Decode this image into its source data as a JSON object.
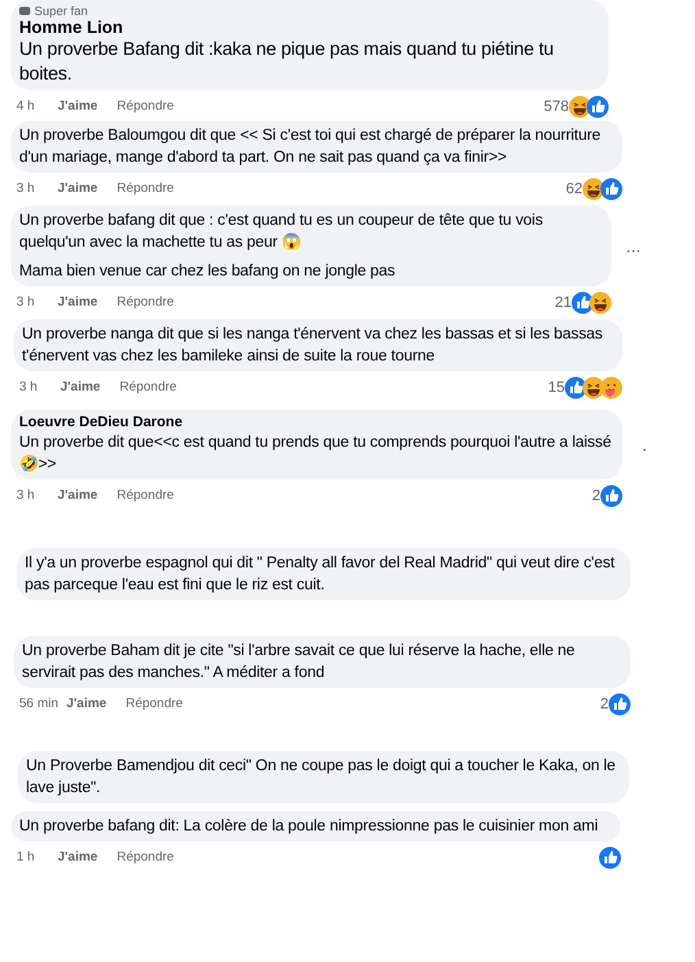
{
  "comments": [
    {
      "badge": "Super fan",
      "author": "Homme Lion",
      "paragraphs": [
        "Un proverbe Bafang dit :kaka ne pique pas mais quand tu piétine tu boites."
      ],
      "time": "4 h",
      "like": "J'aime",
      "reply": "Répondre",
      "count": "578",
      "reactions": [
        {
          "kind": "haha"
        },
        {
          "kind": "like"
        }
      ]
    },
    {
      "paragraphs": [
        "Un proverbe Baloumgou dit que << Si c'est toi qui est chargé de préparer la nourriture d'un mariage, mange d'abord ta part. On ne sait pas quand ça va finir>>"
      ],
      "time": "3 h",
      "like": "J'aime",
      "reply": "Répondre",
      "count": "62",
      "reactions": [
        {
          "kind": "haha"
        },
        {
          "kind": "like"
        }
      ]
    },
    {
      "paragraphs": [
        "Un proverbe bafang dit que : c'est quand tu es un coupeur de tête que tu vois quelqu'un avec la machette tu as peur 😱",
        "Mama bien venue car chez les bafang on ne jongle pas"
      ],
      "time": "3 h",
      "like": "J'aime",
      "reply": "Répondre",
      "count": "21",
      "reactions": [
        {
          "kind": "like"
        },
        {
          "kind": "haha"
        }
      ],
      "menu": "..."
    },
    {
      "paragraphs": [
        "Un proverbe nanga dit que si les nanga t'énervent va chez les bassas et si les bassas t'énervent vas chez les bamileke ainsi de suite la roue tourne"
      ],
      "time": "3 h",
      "like": "J'aime",
      "reply": "Répondre",
      "count": "15",
      "reactions": [
        {
          "kind": "like"
        },
        {
          "kind": "haha"
        },
        {
          "kind": "care"
        }
      ]
    },
    {
      "author": "Loeuvre DeDieu Darone",
      "paragraphs": [
        "Un proverbe dit que<<c est quand tu prends que tu comprends pourquoi l'autre a laissé 🤣>>"
      ],
      "time": "3 h",
      "like": "J'aime",
      "reply": "Répondre",
      "count": "2",
      "reactions": [
        {
          "kind": "like"
        }
      ],
      "menu": "."
    },
    {
      "paragraphs": [
        "Il y'a un proverbe espagnol qui dit \" Penalty all favor del Real Madrid\" qui veut dire c'est pas parceque l'eau est fini que le riz est cuit."
      ]
    },
    {
      "paragraphs": [
        "Un proverbe Baham dit je cite \"si l'arbre savait ce que lui réserve la hache, elle ne servirait pas des manches.\" A méditer a fond"
      ],
      "time": "56 min",
      "like": "J'aime",
      "reply": "Répondre",
      "count": "2",
      "reactions": [
        {
          "kind": "like"
        }
      ]
    },
    {
      "paragraphs": [
        "Un Proverbe Bamendjou dit ceci\" On ne coupe pas le doigt qui a toucher le Kaka, on le lave juste\"."
      ]
    },
    {
      "paragraphs": [
        "Un proverbe bafang dit: La colère de la poule nimpressionne pas le cuisinier mon ami"
      ],
      "time": "1 h",
      "like": "J'aime",
      "reply": "Répondre",
      "reactions": [
        {
          "kind": "like"
        }
      ]
    }
  ]
}
